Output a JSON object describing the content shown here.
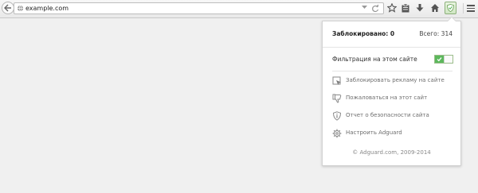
{
  "browser": {
    "url": "example.com",
    "icons": {
      "back": "back-arrow-icon",
      "globe": "globe-icon",
      "reload": "reload-icon",
      "bookmark": "star-icon",
      "library": "clipboard-icon",
      "downloads": "download-icon",
      "home": "home-icon",
      "adguard": "adguard-shield-icon",
      "menu": "hamburger-menu-icon"
    }
  },
  "popup": {
    "blocked_label": "Заблокировано: 0",
    "total_label": "Всего: 314",
    "filter_label": "Фильтрация на этом сайте",
    "filter_enabled": true,
    "actions": [
      {
        "label": "Заблокировать рекламу на сайте",
        "icon": "block-ad-icon"
      },
      {
        "label": "Пожаловаться на этот сайт",
        "icon": "thumbs-down-icon"
      },
      {
        "label": "Отчет о безопасности сайта",
        "icon": "shield-info-icon"
      },
      {
        "label": "Настроить Adguard",
        "icon": "gear-icon"
      }
    ],
    "copyright": "© Adguard.com, 2009-2014"
  },
  "colors": {
    "accent_green": "#5cb85c",
    "popup_text": "#6e6e6e"
  }
}
